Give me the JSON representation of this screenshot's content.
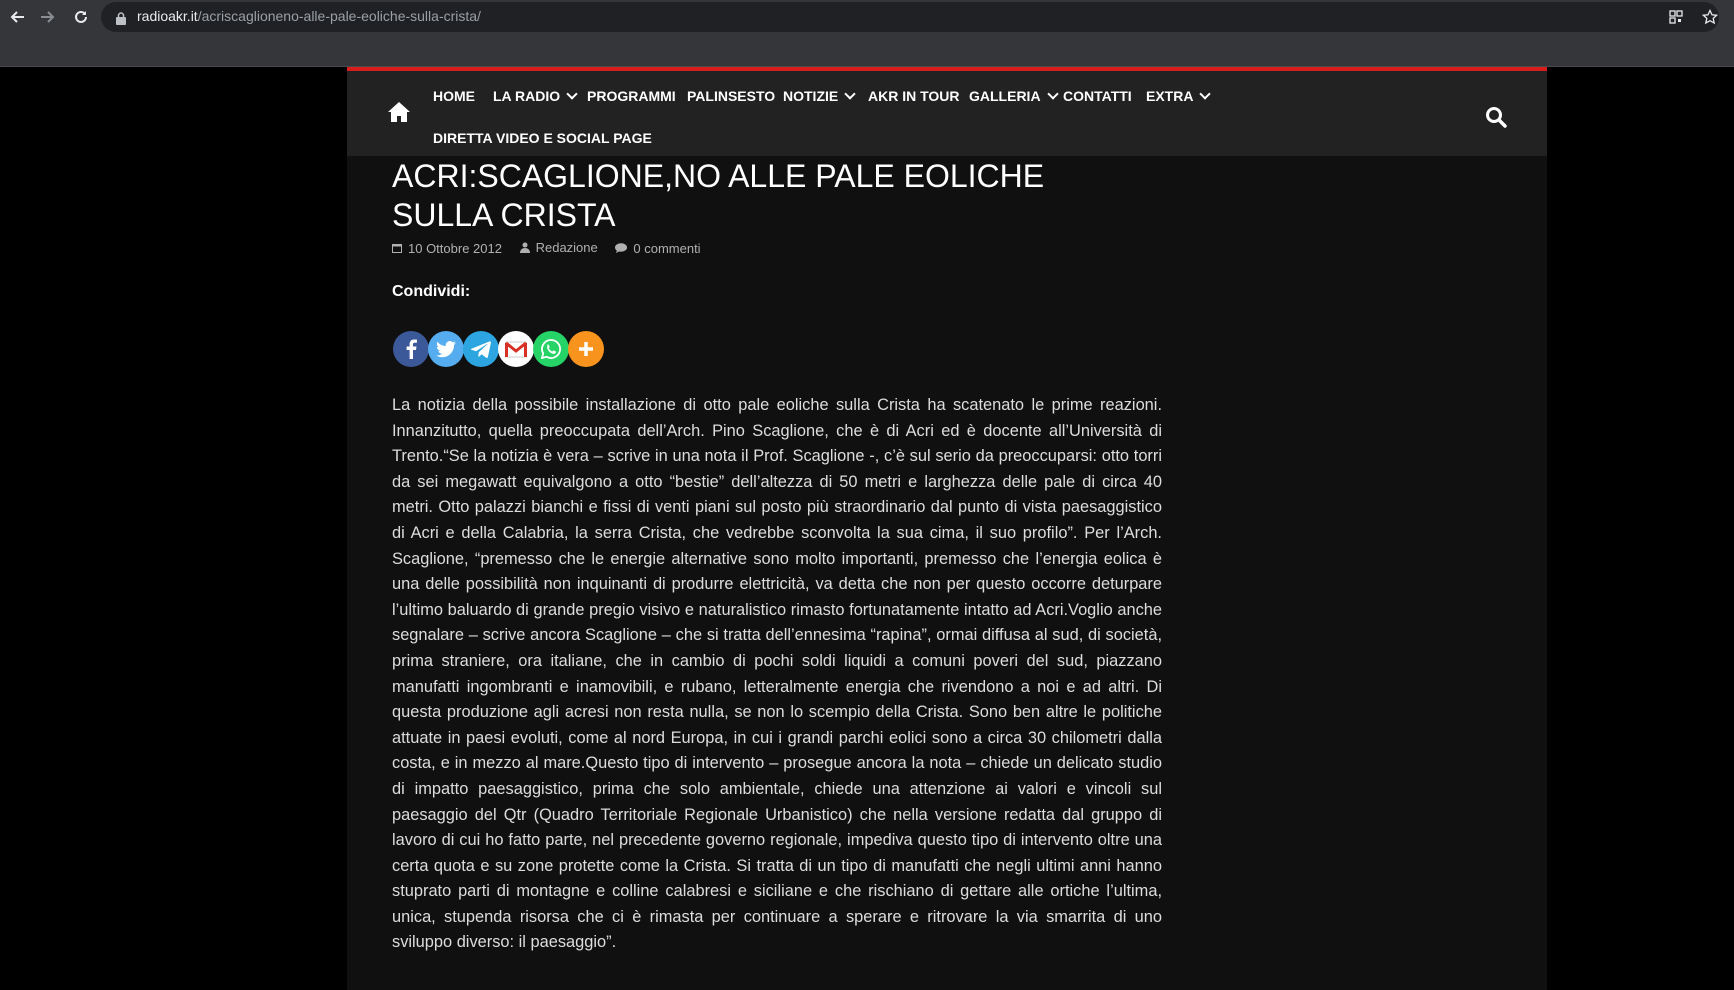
{
  "browser": {
    "url_domain": "radioakr.it",
    "url_path": "/acriscaglioneno-alle-pale-eoliche-sulla-crista/",
    "icons": [
      "back-icon",
      "forward-icon",
      "reload-icon",
      "lock-icon",
      "qr-icon",
      "bookmark-star-icon"
    ]
  },
  "nav": {
    "items": [
      {
        "label": "HOME",
        "has_dropdown": false
      },
      {
        "label": "LA RADIO",
        "has_dropdown": true
      },
      {
        "label": "PROGRAMMI",
        "has_dropdown": false
      },
      {
        "label": "PALINSESTO",
        "has_dropdown": false
      },
      {
        "label": "NOTIZIE",
        "has_dropdown": true
      },
      {
        "label": "AKR IN TOUR",
        "has_dropdown": false
      },
      {
        "label": "GALLERIA",
        "has_dropdown": true
      },
      {
        "label": "CONTATTI",
        "has_dropdown": false
      },
      {
        "label": "EXTRA",
        "has_dropdown": true
      },
      {
        "label": "DIRETTA VIDEO E SOCIAL PAGE",
        "has_dropdown": false
      }
    ],
    "home_icon": "home-icon",
    "search_icon": "search-icon"
  },
  "article": {
    "title": "ACRI:SCAGLIONE,NO ALLE PALE EOLICHE SULLA CRISTA",
    "date": "10 Ottobre 2012",
    "author": "Redazione",
    "comments": "0 commenti",
    "share_label": "Condividi:",
    "body": "La notizia della possibile installazione di otto pale eoliche sulla Crista ha scatenato le prime reazioni. Innanzitutto, quella preoccupata dell’Arch. Pino Scaglione, che è di Acri ed è docente all’Università di Trento.“Se la notizia è vera – scrive in una nota il Prof. Scaglione -, c’è sul serio da preoccuparsi: otto torri da sei megawatt equivalgono a otto “bestie” dell’altezza di 50 metri e larghezza delle pale di circa 40 metri. Otto palazzi bianchi e fissi di venti piani sul posto più straordinario dal punto di vista paesaggistico di Acri e della Calabria, la serra Crista, che vedrebbe sconvolta la sua cima, il suo profilo”. Per l’Arch. Scaglione, “premesso che le energie alternative sono molto importanti, premesso che l’energia eolica è una delle possibilità non inquinanti di produrre elettricità, va detta che non per questo occorre deturpare l’ultimo baluardo di grande pregio visivo e naturalistico rimasto fortunatamente intatto ad Acri.Voglio anche segnalare – scrive ancora Scaglione – che si tratta dell’ennesima “rapina”, ormai diffusa al sud, di società, prima straniere, ora italiane, che in cambio di pochi soldi liquidi a comuni poveri del sud, piazzano manufatti ingombranti e inamovibili, e rubano, letteralmente energia che rivendono a noi e ad altri. Di questa produzione agli acresi non resta nulla, se non lo scempio della Crista. Sono ben altre le politiche attuate in paesi evoluti, come al nord Europa, in cui i grandi parchi eolici sono a circa 30 chilometri dalla costa, e in mezzo al mare.Questo tipo di intervento – prosegue ancora la nota – chiede un delicato studio di impatto paesaggistico, prima che solo ambientale, chiede una attenzione ai valori e vincoli sul paesaggio del Qtr (Quadro Territoriale Regionale Urbanistico) che nella versione redatta dal gruppo di lavoro di cui ho fatto parte, nel precedente governo regionale, impediva questo tipo di intervento oltre una certa quota e su zone protette come la Crista. Si tratta di un tipo di manufatti che negli ultimi anni hanno stuprato parti di montagne e colline calabresi e siciliane e che rischiano di gettare alle ortiche l’ultima, unica, stupenda risorsa che ci è rimasta per continuare a sperare e ritrovare la via smarrita di uno sviluppo diverso: il paesaggio”."
  },
  "share_buttons": [
    {
      "name": "facebook",
      "icon": "facebook-icon",
      "color": "#3b5998"
    },
    {
      "name": "twitter",
      "icon": "twitter-icon",
      "color": "#55acee"
    },
    {
      "name": "telegram",
      "icon": "telegram-icon",
      "color": "#2ca5e0"
    },
    {
      "name": "gmail",
      "icon": "gmail-icon",
      "color": "#ffffff"
    },
    {
      "name": "whatsapp",
      "icon": "whatsapp-icon",
      "color": "#25d366"
    },
    {
      "name": "more",
      "icon": "plus-icon",
      "color": "#f8941d"
    }
  ],
  "colors": {
    "accent_red": "#d81d1d",
    "header_bg": "#222222",
    "content_bg": "#101010",
    "page_bg": "#000000"
  }
}
